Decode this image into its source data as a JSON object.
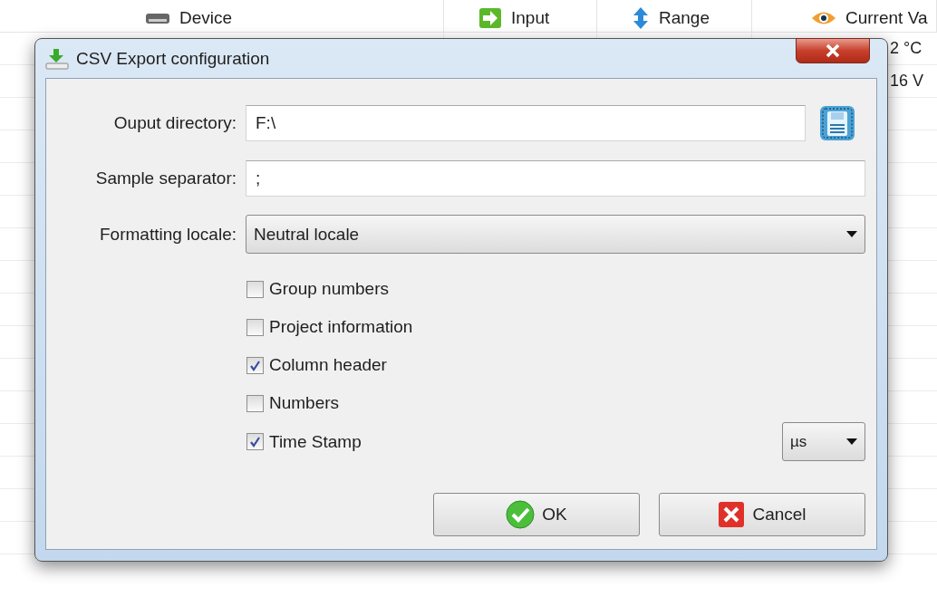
{
  "table": {
    "columns": [
      {
        "label": "Device"
      },
      {
        "label": "Input"
      },
      {
        "label": "Range"
      },
      {
        "label": "Current Va"
      }
    ],
    "rows": [
      {
        "column_4": "2 °C"
      },
      {
        "column_4": "16 V"
      }
    ]
  },
  "dialog": {
    "title": "CSV Export configuration",
    "fields": [
      {
        "label": "Ouput directory:",
        "value": "F:\\",
        "browse": true
      },
      {
        "label": "Sample separator:",
        "value": ";",
        "browse": false
      }
    ],
    "locale": {
      "label": "Formatting locale:",
      "value": "Neutral locale"
    },
    "checkboxes": [
      {
        "label": "Group numbers",
        "checked": false
      },
      {
        "label": "Project information",
        "checked": false
      },
      {
        "label": "Column header",
        "checked": true
      },
      {
        "label": "Numbers",
        "checked": false
      },
      {
        "label": "Time Stamp",
        "checked": true
      }
    ],
    "time_unit": "µs",
    "buttons": [
      {
        "label": "OK",
        "kind": "ok"
      },
      {
        "label": "Cancel",
        "kind": "cancel"
      }
    ]
  }
}
